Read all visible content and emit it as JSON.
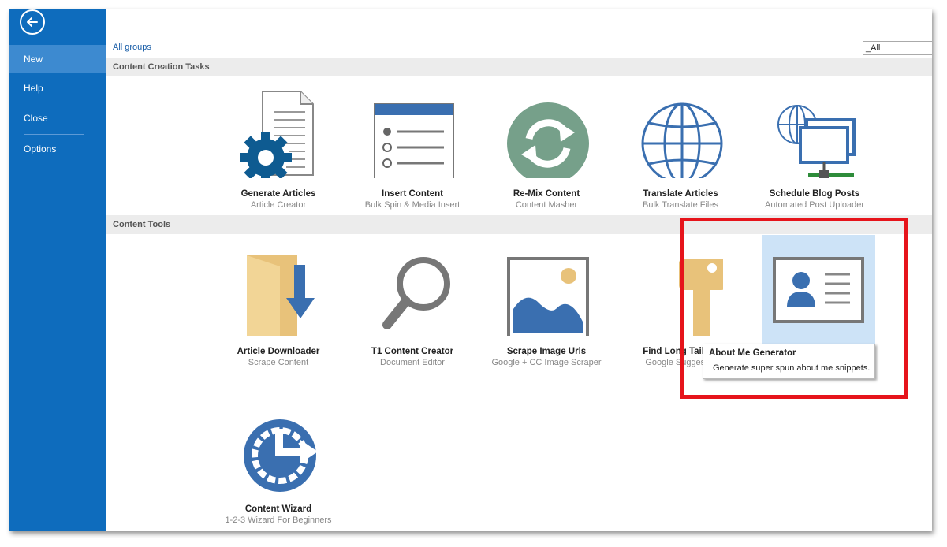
{
  "sidebar": {
    "items": [
      {
        "label": "New",
        "active": true
      },
      {
        "label": "Help"
      },
      {
        "label": "Close"
      },
      {
        "label": "Options"
      }
    ]
  },
  "toolbar": {
    "breadcrumb": "All groups",
    "filter_value": "_All"
  },
  "groups": [
    {
      "title": "Content Creation Tasks",
      "tiles": [
        {
          "title": "Generate Articles",
          "subtitle": "Article Creator",
          "icon": "document-gear-icon"
        },
        {
          "title": "Insert Content",
          "subtitle": "Bulk Spin & Media Insert",
          "icon": "list-window-icon"
        },
        {
          "title": "Re-Mix Content",
          "subtitle": "Content Masher",
          "icon": "refresh-circle-icon"
        },
        {
          "title": "Translate Articles",
          "subtitle": "Bulk Translate Files",
          "icon": "globe-icon"
        },
        {
          "title": "Schedule Blog Posts",
          "subtitle": "Automated Post Uploader",
          "icon": "network-monitors-icon"
        }
      ]
    },
    {
      "title": "Content Tools",
      "tiles": [
        {
          "title": "Article Downloader",
          "subtitle": "Scrape Content",
          "icon": "folder-download-icon"
        },
        {
          "title": "T1 Content Creator",
          "subtitle": "Document Editor",
          "icon": "magnifier-icon"
        },
        {
          "title": "Scrape Image Urls",
          "subtitle": "Google + CC Image Scraper",
          "icon": "picture-icon"
        },
        {
          "title": "Find Long Tail Ke",
          "subtitle": "Google Suggest S",
          "icon": "key-icon"
        },
        {
          "title": "",
          "subtitle": "",
          "icon": "id-card-icon",
          "hovered": true
        },
        {
          "title": "Content Wizard",
          "subtitle": "1-2-3 Wizard For Beginners",
          "icon": "wizard-clock-icon"
        }
      ]
    }
  ],
  "tooltip": {
    "title": "About Me Generator",
    "description": "Generate super spun about me snippets."
  },
  "colors": {
    "sidebar": "#0e6cbd",
    "sidebar_active": "#3d8ad0",
    "icon_blue": "#3a6fb0",
    "icon_green": "#76a08a",
    "icon_tan": "#e8c27a",
    "highlight": "#e6141b"
  }
}
